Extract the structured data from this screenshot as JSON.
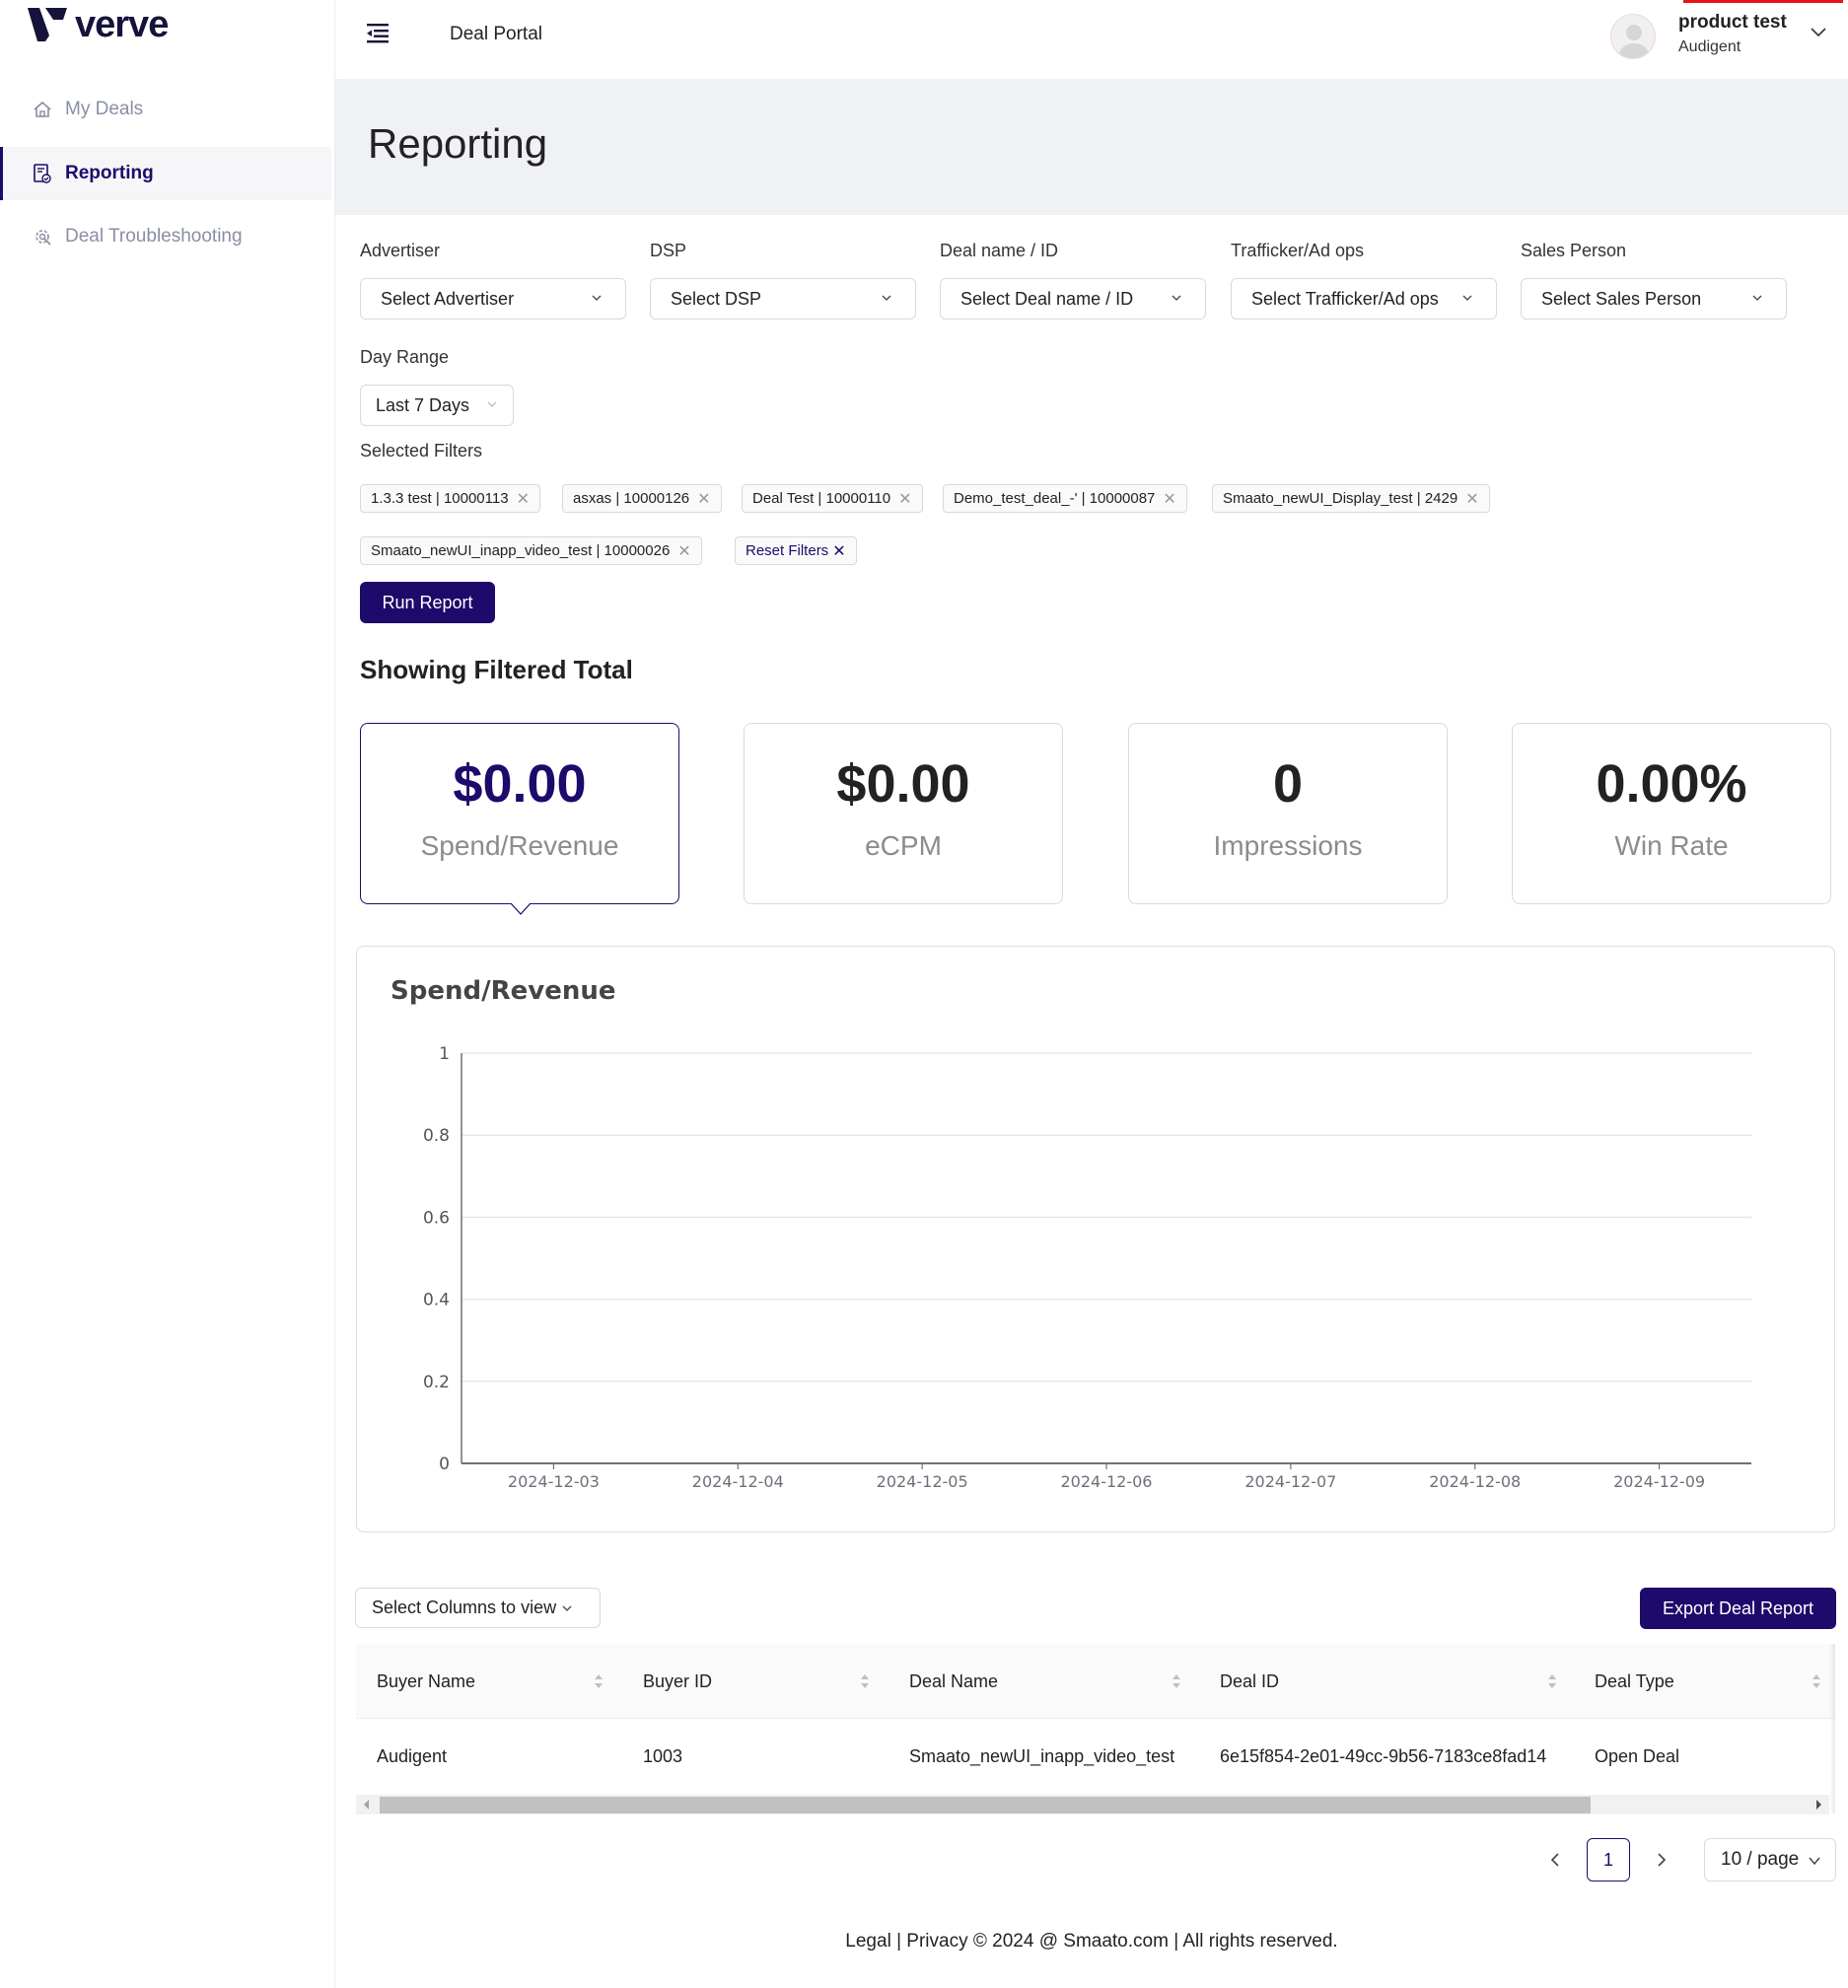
{
  "brand": {
    "name": "verve",
    "accent": "#1d0a6b"
  },
  "sidebar": {
    "items": [
      {
        "label": "My Deals",
        "icon": "home-icon",
        "active": false
      },
      {
        "label": "Reporting",
        "icon": "report-icon",
        "active": true
      },
      {
        "label": "Deal Troubleshooting",
        "icon": "gear-wrench-icon",
        "active": false
      }
    ]
  },
  "header": {
    "portal_title": "Deal Portal",
    "user": {
      "name": "product test",
      "org": "Audigent"
    }
  },
  "page": {
    "title": "Reporting"
  },
  "filters": {
    "advertiser": {
      "label": "Advertiser",
      "placeholder": "Select Advertiser"
    },
    "dsp": {
      "label": "DSP",
      "placeholder": "Select DSP"
    },
    "deal": {
      "label": "Deal name / ID",
      "placeholder": "Select Deal name / ID"
    },
    "trafficker": {
      "label": "Trafficker/Ad ops",
      "placeholder": "Select Trafficker/Ad ops"
    },
    "sales": {
      "label": "Sales Person",
      "placeholder": "Select Sales Person"
    },
    "day_range": {
      "label": "Day Range",
      "value": "Last 7 Days"
    },
    "selected_label": "Selected Filters",
    "chips": [
      "1.3.3 test | 10000113",
      "asxas | 10000126",
      "Deal Test | 10000110",
      "Demo_test_deal_-' | 10000087",
      "Smaato_newUI_Display_test | 2429",
      "Smaato_newUI_inapp_video_test | 10000026"
    ],
    "reset_label": "Reset Filters",
    "run_label": "Run Report"
  },
  "totals": {
    "title": "Showing Filtered Total",
    "cards": [
      {
        "value": "$0.00",
        "label": "Spend/Revenue",
        "active": true
      },
      {
        "value": "$0.00",
        "label": "eCPM",
        "active": false
      },
      {
        "value": "0",
        "label": "Impressions",
        "active": false
      },
      {
        "value": "0.00%",
        "label": "Win Rate",
        "active": false
      }
    ]
  },
  "chart_data": {
    "type": "line",
    "title": "Spend/Revenue",
    "xlabel": "",
    "ylabel": "",
    "categories": [
      "2024-12-03",
      "2024-12-04",
      "2024-12-05",
      "2024-12-06",
      "2024-12-07",
      "2024-12-08",
      "2024-12-09"
    ],
    "series": [],
    "ylim": [
      0,
      1
    ],
    "yticks": [
      "0",
      "0.2",
      "0.4",
      "0.6",
      "0.8",
      "1"
    ],
    "grid": true,
    "legend": "none"
  },
  "table": {
    "columns_select_label": "Select Columns to view",
    "export_label": "Export Deal Report",
    "columns": [
      "Buyer Name",
      "Buyer ID",
      "Deal Name",
      "Deal ID",
      "Deal Type"
    ],
    "rows": [
      [
        "Audigent",
        "1003",
        "Smaato_newUI_inapp_video_test",
        "6e15f854-2e01-49cc-9b56-7183ce8fad14",
        "Open Deal"
      ]
    ]
  },
  "pagination": {
    "current_page": "1",
    "page_size": "10 / page"
  },
  "footer": {
    "legal": "Legal",
    "privacy": "Privacy",
    "copyright": "© 2024 @ Smaato.com | All rights reserved."
  }
}
